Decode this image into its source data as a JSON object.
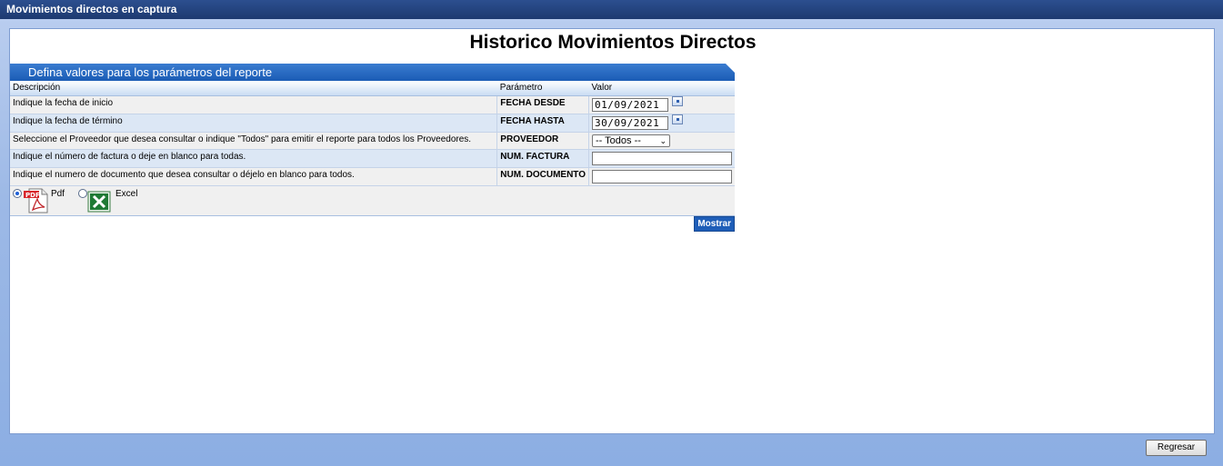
{
  "window": {
    "title": "Movimientos directos en captura"
  },
  "page": {
    "title": "Historico Movimientos Directos"
  },
  "panel": {
    "header": "Defina valores para los parámetros del reporte",
    "columns": {
      "description": "Descripción",
      "parameter": "Parámetro",
      "value": "Valor"
    },
    "rows": [
      {
        "description": "Indique la fecha de inicio",
        "parameter": "FECHA DESDE",
        "value": "01/09/2021"
      },
      {
        "description": "Indique la fecha de término",
        "parameter": "FECHA HASTA",
        "value": "30/09/2021"
      },
      {
        "description": "Seleccione el Proveedor que desea consultar o indique \"Todos\" para emitir el reporte para todos los Proveedores.",
        "parameter": "PROVEEDOR",
        "value": "-- Todos --"
      },
      {
        "description": "Indique el número de factura o deje en blanco para todas.",
        "parameter": "NUM. FACTURA",
        "value": ""
      },
      {
        "description": "Indique el numero de documento que desea consultar o déjelo en blanco para todos.",
        "parameter": "NUM. DOCUMENTO",
        "value": ""
      }
    ],
    "format": {
      "selected": "pdf",
      "pdf_label": "Pdf",
      "excel_label": "Excel"
    },
    "show_button": "Mostrar"
  },
  "footer": {
    "back_button": "Regresar"
  },
  "icons": {
    "pdf": "pdf-file-icon",
    "excel": "excel-file-icon",
    "calendar": "calendar-icon",
    "select": "chevron-down-icon"
  },
  "colors": {
    "titlebar": "#1d3a70",
    "panel_header": "#1b5cb5",
    "button": "#1f5eb8",
    "background": "#8fb0e3"
  }
}
